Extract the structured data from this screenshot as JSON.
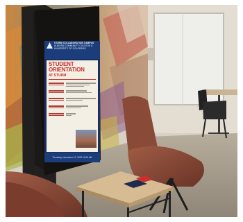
{
  "kiosk_screen": {
    "org_name": "STURM COLLABORATION CAMPUS",
    "org_subtitle": "AURORA COMMUNITY COLLEGE & UNIVERSITY OF COLORADO",
    "title": "STUDENT\nORIENTATION",
    "subtitle": "AT STURM",
    "footer": "Thursday, November 10, 2022 10:00 AM"
  },
  "colors": {
    "screen_navy": "#1b3d7c",
    "title_red": "#c8302c",
    "panel_cream": "#f4efe4",
    "chair_leather": "#8a4a38",
    "wall_beige": "#d8d2c6"
  }
}
